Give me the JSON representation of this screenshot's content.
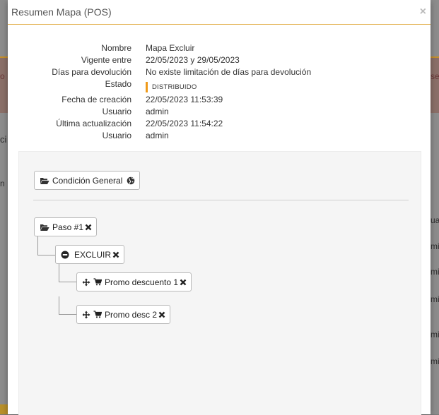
{
  "modal": {
    "title": "Resumen Mapa (POS)",
    "close_glyph": "×"
  },
  "details": [
    {
      "label": "Nombre",
      "value": "Mapa Excluir"
    },
    {
      "label": "Vigente entre",
      "value": "22/05/2023 y 29/05/2023"
    },
    {
      "label": "Días para devolución",
      "value": "No existe limitación de días para devolución"
    },
    {
      "label": "Estado",
      "value": "DISTRIBUIDO"
    },
    {
      "label": "Fecha de creación",
      "value": "22/05/2023 11:53:39"
    },
    {
      "label": "Usuario",
      "value": "admin"
    },
    {
      "label": "Última actualización",
      "value": "22/05/2023 11:54:22"
    },
    {
      "label": "Usuario",
      "value": "admin"
    }
  ],
  "status_color": "#ef9a1a",
  "tree": {
    "general": {
      "label": "Condición General",
      "icon": "folder-open-icon",
      "trailing_icon": "globe-icon"
    },
    "step": {
      "label": "Paso #1",
      "icon": "folder-open-icon",
      "remove_icon": "remove-icon"
    },
    "action": {
      "label": "EXCLUIR",
      "icon": "minus-circle-icon",
      "remove_icon": "remove-icon"
    },
    "items": [
      {
        "label": "Promo descuento 1",
        "icons": [
          "move-icon",
          "cart-icon"
        ],
        "remove_icon": "remove-icon"
      },
      {
        "label": "Promo desc 2",
        "icons": [
          "move-icon",
          "cart-icon"
        ],
        "remove_icon": "remove-icon"
      }
    ]
  },
  "background_fragments": {
    "left_band": "o",
    "right_band": "se",
    "left_mid": "ci",
    "left_input": "n",
    "right_rows": [
      "ua",
      "mi",
      "mi",
      "mi",
      "mi",
      "mi"
    ],
    "bottom_left": "y"
  }
}
